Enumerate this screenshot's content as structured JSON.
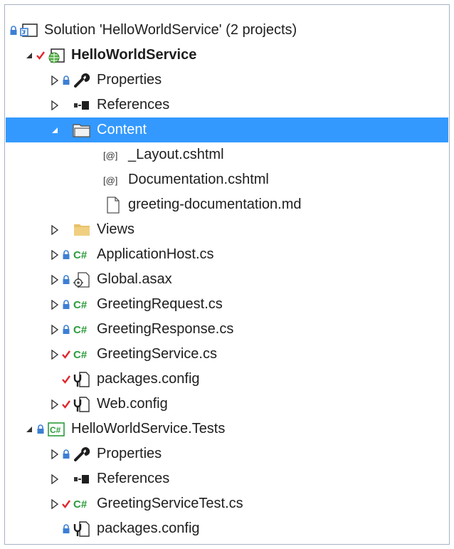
{
  "solution_explorer": {
    "colors": {
      "selection": "#3399ff",
      "check": "#e0262b",
      "lock": "#3d7fd4",
      "csharp": "#2b9c3c",
      "folder": "#e8c16b"
    },
    "items": [
      {
        "label": "Solution 'HelloWorldService' (2 projects)",
        "icon": "solution-icon",
        "badge": "lock-icon"
      },
      {
        "label": "HelloWorldService",
        "icon": "web-project-icon",
        "badge": "checkmark-icon",
        "expanded": true
      },
      {
        "label": "Properties",
        "icon": "wrench-icon",
        "badge": "lock-icon",
        "expanded": false
      },
      {
        "label": "References",
        "icon": "references-icon",
        "expanded": false
      },
      {
        "label": "Content",
        "icon": "folder-open-icon",
        "expanded": true,
        "selected": true
      },
      {
        "label": "_Layout.cshtml",
        "icon": "cshtml-icon"
      },
      {
        "label": "Documentation.cshtml",
        "icon": "cshtml-icon"
      },
      {
        "label": "greeting-documentation.md",
        "icon": "document-icon"
      },
      {
        "label": "Views",
        "icon": "folder-icon",
        "expanded": false
      },
      {
        "label": "ApplicationHost.cs",
        "icon": "csharp-file-icon",
        "badge": "lock-icon",
        "expanded": false
      },
      {
        "label": "Global.asax",
        "icon": "global-asax-icon",
        "badge": "lock-icon",
        "expanded": false
      },
      {
        "label": "GreetingRequest.cs",
        "icon": "csharp-file-icon",
        "badge": "lock-icon",
        "expanded": false
      },
      {
        "label": "GreetingResponse.cs",
        "icon": "csharp-file-icon",
        "badge": "lock-icon",
        "expanded": false
      },
      {
        "label": "GreetingService.cs",
        "icon": "csharp-file-icon",
        "badge": "checkmark-icon",
        "expanded": false
      },
      {
        "label": "packages.config",
        "icon": "config-icon",
        "badge": "checkmark-icon"
      },
      {
        "label": "Web.config",
        "icon": "config-icon",
        "badge": "checkmark-icon",
        "expanded": false
      },
      {
        "label": "HelloWorldService.Tests",
        "icon": "csharp-project-icon",
        "badge": "lock-icon",
        "expanded": true
      },
      {
        "label": "Properties",
        "icon": "wrench-icon",
        "badge": "lock-icon",
        "expanded": false
      },
      {
        "label": "References",
        "icon": "references-icon",
        "expanded": false
      },
      {
        "label": "GreetingServiceTest.cs",
        "icon": "csharp-file-icon",
        "badge": "checkmark-icon",
        "expanded": false
      },
      {
        "label": "packages.config",
        "icon": "config-icon",
        "badge": "lock-icon"
      }
    ]
  }
}
